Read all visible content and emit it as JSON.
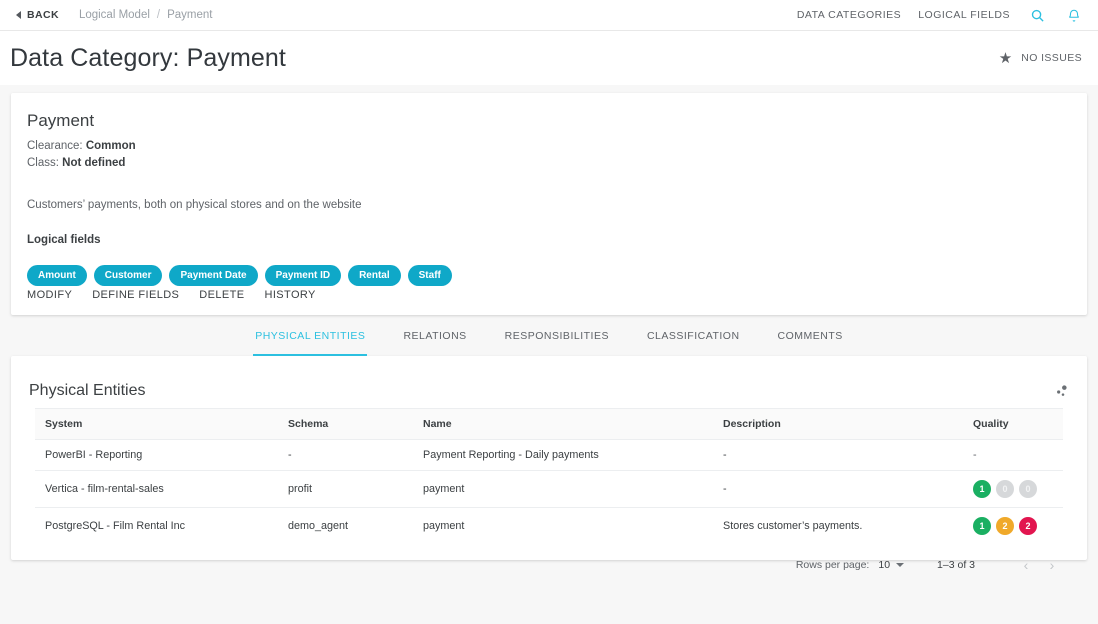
{
  "topbar": {
    "back_label": "BACK",
    "breadcrumb": {
      "root": "Logical Model",
      "separator": "/",
      "current": "Payment"
    },
    "nav": [
      {
        "label": "DATA CATEGORIES",
        "name": "nav-data-categories"
      },
      {
        "label": "LOGICAL FIELDS",
        "name": "nav-logical-fields"
      }
    ],
    "icons": {
      "search": "search-icon",
      "notifications": "bell-icon"
    },
    "accent_color": "#2cc0e0"
  },
  "page": {
    "title": "Data Category: Payment",
    "star_glyph": "★",
    "issues_label": "NO ISSUES"
  },
  "info_card": {
    "entity_name": "Payment",
    "clearance_label": "Clearance:",
    "clearance_value": "Common",
    "class_label": "Class:",
    "class_value": "Not defined",
    "description": "Customers’ payments, both on physical stores and on the website",
    "logical_fields_label": "Logical fields",
    "chips": [
      "Amount",
      "Customer",
      "Payment Date",
      "Payment ID",
      "Rental",
      "Staff"
    ],
    "chip_color": "#0fa8c8",
    "actions": [
      "MODIFY",
      "DEFINE FIELDS",
      "DELETE",
      "HISTORY"
    ]
  },
  "tabs": [
    {
      "label": "PHYSICAL ENTITIES",
      "active": true
    },
    {
      "label": "RELATIONS",
      "active": false
    },
    {
      "label": "RESPONSIBILITIES",
      "active": false
    },
    {
      "label": "CLASSIFICATION",
      "active": false
    },
    {
      "label": "COMMENTS",
      "active": false
    }
  ],
  "table_card": {
    "title": "Physical Entities",
    "head_icon": "share-nodes-icon",
    "columns": [
      "System",
      "Schema",
      "Name",
      "Description",
      "Quality"
    ],
    "rows": [
      {
        "system": "PowerBI - Reporting",
        "schema": "-",
        "name": "Payment Reporting - Daily payments",
        "description": "-",
        "quality": {
          "type": "dash",
          "value": "-"
        }
      },
      {
        "system": "Vertica - film-rental-sales",
        "schema": "profit",
        "name": "payment",
        "description": "-",
        "quality": {
          "type": "badges",
          "badges": [
            {
              "value": "1",
              "color": "green"
            },
            {
              "value": "0",
              "color": "grey"
            },
            {
              "value": "0",
              "color": "grey"
            }
          ]
        }
      },
      {
        "system": "PostgreSQL - Film Rental Inc",
        "schema": "demo_agent",
        "name": "payment",
        "description": "Stores customer’s payments.",
        "quality": {
          "type": "badges",
          "badges": [
            {
              "value": "1",
              "color": "green"
            },
            {
              "value": "2",
              "color": "amber"
            },
            {
              "value": "2",
              "color": "red"
            }
          ]
        }
      }
    ],
    "pagination": {
      "rows_per_page_label": "Rows per page:",
      "rows_per_page_value": "10",
      "range_label": "1–3 of 3",
      "prev_glyph": "‹",
      "next_glyph": "›"
    },
    "badge_colors": {
      "green": "#1aaf62",
      "grey": "#d6d8da",
      "amber": "#f0a92a",
      "red": "#e2154f"
    }
  }
}
